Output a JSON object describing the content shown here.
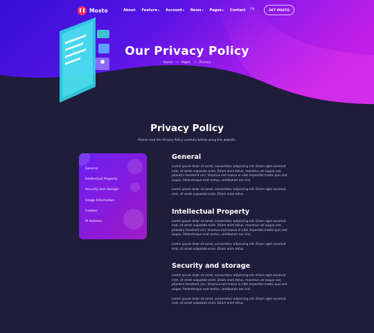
{
  "nav": {
    "logo_text": "Mosto",
    "items": [
      {
        "label": "About",
        "has_dropdown": false
      },
      {
        "label": "Feature",
        "has_dropdown": true
      },
      {
        "label": "Account",
        "has_dropdown": true
      },
      {
        "label": "News",
        "has_dropdown": true
      },
      {
        "label": "Pages",
        "has_dropdown": true
      },
      {
        "label": "Contact",
        "has_dropdown": false
      }
    ],
    "language": "EN",
    "cta_label": "GET MOSTO"
  },
  "hero": {
    "title": "Our Privacy Policy",
    "breadcrumb": [
      "Home",
      "Pages",
      "Privacy"
    ],
    "breadcrumb_separator": "→"
  },
  "page": {
    "title": "Privacy Policy",
    "subtitle": "Please read this Privacy Policy carefully before using this website."
  },
  "sidebar": {
    "items": [
      "General",
      "Intellectual Property",
      "Security and storage",
      "Usage Information",
      "Cookies",
      "IP Address"
    ]
  },
  "sections": [
    {
      "heading": "General",
      "paragraphs": [
        "Lorem ipsum dolor sit amet, consectetur adipiscing elit. Etiam eget euismod erat, sit amet vulputate enim. Etiam enim tellus, maximus vel augue sed, pharetra hendrerit orci. Vivamus sed massa in nibh imperdiet mattis quis sed augue. Pellentesque erat metus, vestibulum nec nisl.",
        "Lorem ipsum dolor sit amet, consectetur adipiscing elit. Etiam eget euismod erat, sit amet vulputate enim. Etiam enim tellus."
      ]
    },
    {
      "heading": "Intellectual Property",
      "paragraphs": [
        "Lorem ipsum dolor sit amet, consectetur adipiscing elit. Etiam eget euismod erat, sit amet vulputate enim. Etiam enim tellus, maximus vel augue sed, pharetra hendrerit orci. Vivamus sed massa in nibh imperdiet mattis quis sed augue. Pellentesque erat metus, vestibulum nec nisl.",
        "Lorem ipsum dolor sit amet, consectetur adipiscing elit. Etiam eget euismod erat, sit amet vulputate enim. Etiam enim tellus."
      ]
    },
    {
      "heading": "Security and storage",
      "paragraphs": [
        "Lorem ipsum dolor sit amet, consectetur adipiscing elit. Etiam eget euismod erat, sit amet vulputate enim. Etiam enim tellus, maximus vel augue sed, pharetra hendrerit orci. Vivamus sed massa in nibh imperdiet mattis quis sed augue. Pellentesque erat metus, vestibulum nec nisl.",
        "Lorem ipsum dolor sit amet, consectetur adipiscing elit. Etiam eget euismod erat, sit amet vulputate enim. Etiam enim tellus."
      ]
    }
  ],
  "colors": {
    "background": "#1f1d3a",
    "hero_start": "#3b10d8",
    "hero_end": "#b41fe8",
    "sidebar_start": "#6a22f2",
    "sidebar_end": "#a01cc8",
    "logo": "#ff2f5e"
  },
  "icons": {
    "logo": "mosto-logo-icon",
    "dropdown": "chevron-down-icon",
    "breadcrumb_sep": "arrow-right-icon",
    "illustration": "privacy-documents-illustration"
  }
}
